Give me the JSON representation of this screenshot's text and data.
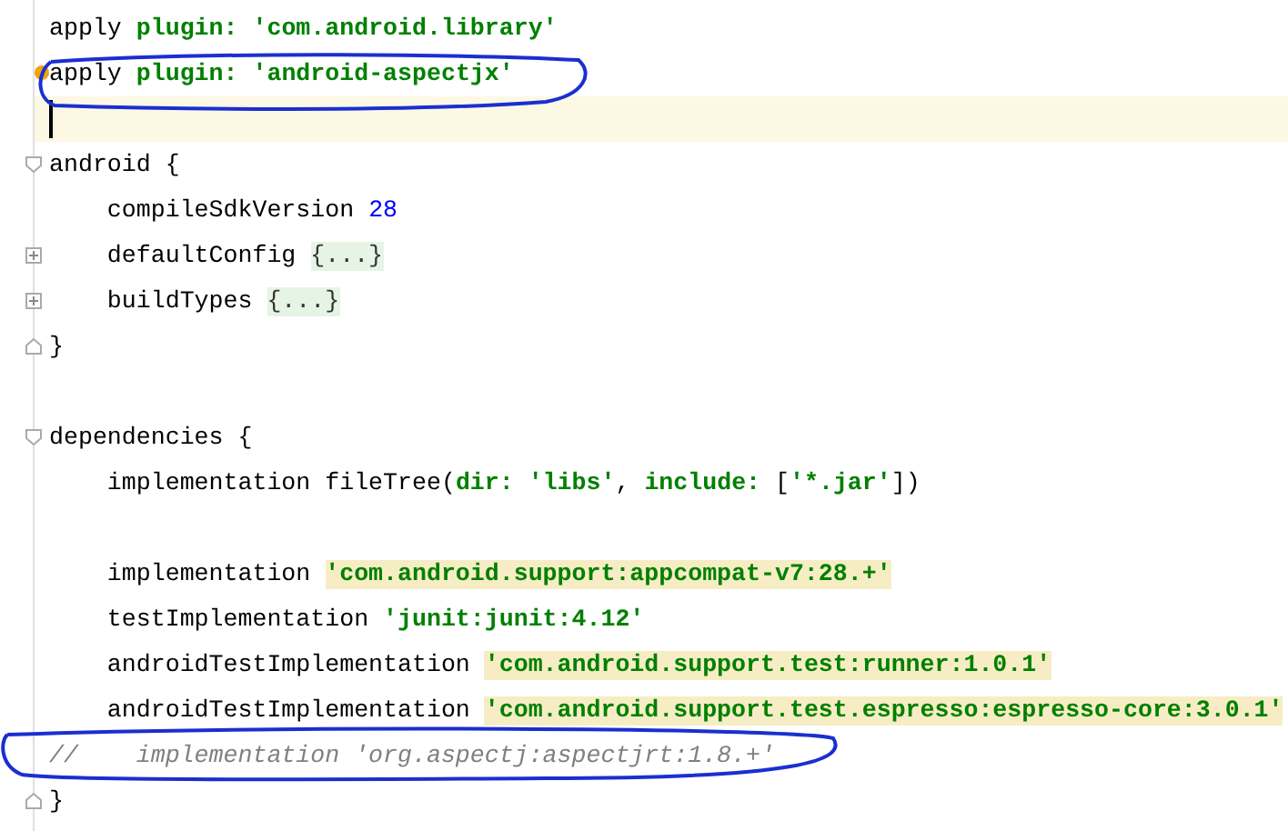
{
  "editor": {
    "lines": [
      {
        "kind": "plain",
        "current": false,
        "bulb": false,
        "tokens": [
          {
            "kind": "plain",
            "text": "apply "
          },
          {
            "kind": "keyword",
            "text": "plugin: "
          },
          {
            "kind": "string",
            "text": "'com.android.library'"
          }
        ]
      },
      {
        "kind": "plain",
        "current": false,
        "bulb": true,
        "tokens": [
          {
            "kind": "plain",
            "text": "apply "
          },
          {
            "kind": "keyword",
            "text": "plugin: "
          },
          {
            "kind": "string",
            "text": "'android-aspectjx'"
          }
        ]
      },
      {
        "kind": "plain",
        "current": true,
        "bulb": false
      },
      {
        "kind": "fold-start",
        "current": false,
        "bulb": false,
        "tokens": [
          {
            "kind": "plain",
            "text": "android {"
          }
        ]
      },
      {
        "kind": "plain",
        "current": false,
        "bulb": false,
        "tokens": [
          {
            "kind": "plain",
            "text": "    compileSdkVersion "
          },
          {
            "kind": "number",
            "text": "28"
          }
        ]
      },
      {
        "kind": "collapsed",
        "current": false,
        "bulb": false,
        "tokens": [
          {
            "kind": "plain",
            "text": "    defaultConfig "
          },
          {
            "kind": "folded",
            "text": "{...}"
          }
        ]
      },
      {
        "kind": "collapsed",
        "current": false,
        "bulb": false,
        "tokens": [
          {
            "kind": "plain",
            "text": "    buildTypes "
          },
          {
            "kind": "folded",
            "text": "{...}"
          }
        ]
      },
      {
        "kind": "fold-end",
        "current": false,
        "bulb": false,
        "tokens": [
          {
            "kind": "plain",
            "text": "}"
          }
        ]
      },
      {
        "kind": "plain",
        "current": false,
        "bulb": false
      },
      {
        "kind": "fold-start",
        "current": false,
        "bulb": false,
        "tokens": [
          {
            "kind": "plain",
            "text": "dependencies {"
          }
        ]
      },
      {
        "kind": "plain",
        "current": false,
        "bulb": false,
        "tokens": [
          {
            "kind": "plain",
            "text": "    implementation fileTree("
          },
          {
            "kind": "keyword",
            "text": "dir: "
          },
          {
            "kind": "string",
            "text": "'libs'"
          },
          {
            "kind": "plain",
            "text": ", "
          },
          {
            "kind": "keyword",
            "text": "include: "
          },
          {
            "kind": "plain",
            "text": "["
          },
          {
            "kind": "string",
            "text": "'*.jar'"
          },
          {
            "kind": "plain",
            "text": "])"
          }
        ]
      },
      {
        "kind": "plain",
        "current": false,
        "bulb": false
      },
      {
        "kind": "plain",
        "current": false,
        "bulb": false,
        "tokens": [
          {
            "kind": "plain",
            "text": "    implementation "
          },
          {
            "kind": "flagged-string",
            "text": "'com.android.support:appcompat-v7:28.+'"
          }
        ]
      },
      {
        "kind": "plain",
        "current": false,
        "bulb": false,
        "tokens": [
          {
            "kind": "plain",
            "text": "    testImplementation "
          },
          {
            "kind": "string",
            "text": "'junit:junit:4.12'"
          }
        ]
      },
      {
        "kind": "plain",
        "current": false,
        "bulb": false,
        "tokens": [
          {
            "kind": "plain",
            "text": "    androidTestImplementation "
          },
          {
            "kind": "flagged-string",
            "text": "'com.android.support.test:runner:1.0.1'"
          }
        ]
      },
      {
        "kind": "plain",
        "current": false,
        "bulb": false,
        "tokens": [
          {
            "kind": "plain",
            "text": "    androidTestImplementation "
          },
          {
            "kind": "flagged-string",
            "text": "'com.android.support.test.espresso:espresso-core:3.0.1'"
          }
        ]
      },
      {
        "kind": "plain",
        "current": false,
        "bulb": false,
        "tokens": [
          {
            "kind": "comment",
            "text": "//    implementation 'org.aspectj:aspectjrt:1.8.+'"
          }
        ]
      },
      {
        "kind": "fold-end",
        "current": false,
        "bulb": false,
        "tokens": [
          {
            "kind": "plain",
            "text": "}"
          }
        ]
      }
    ]
  }
}
